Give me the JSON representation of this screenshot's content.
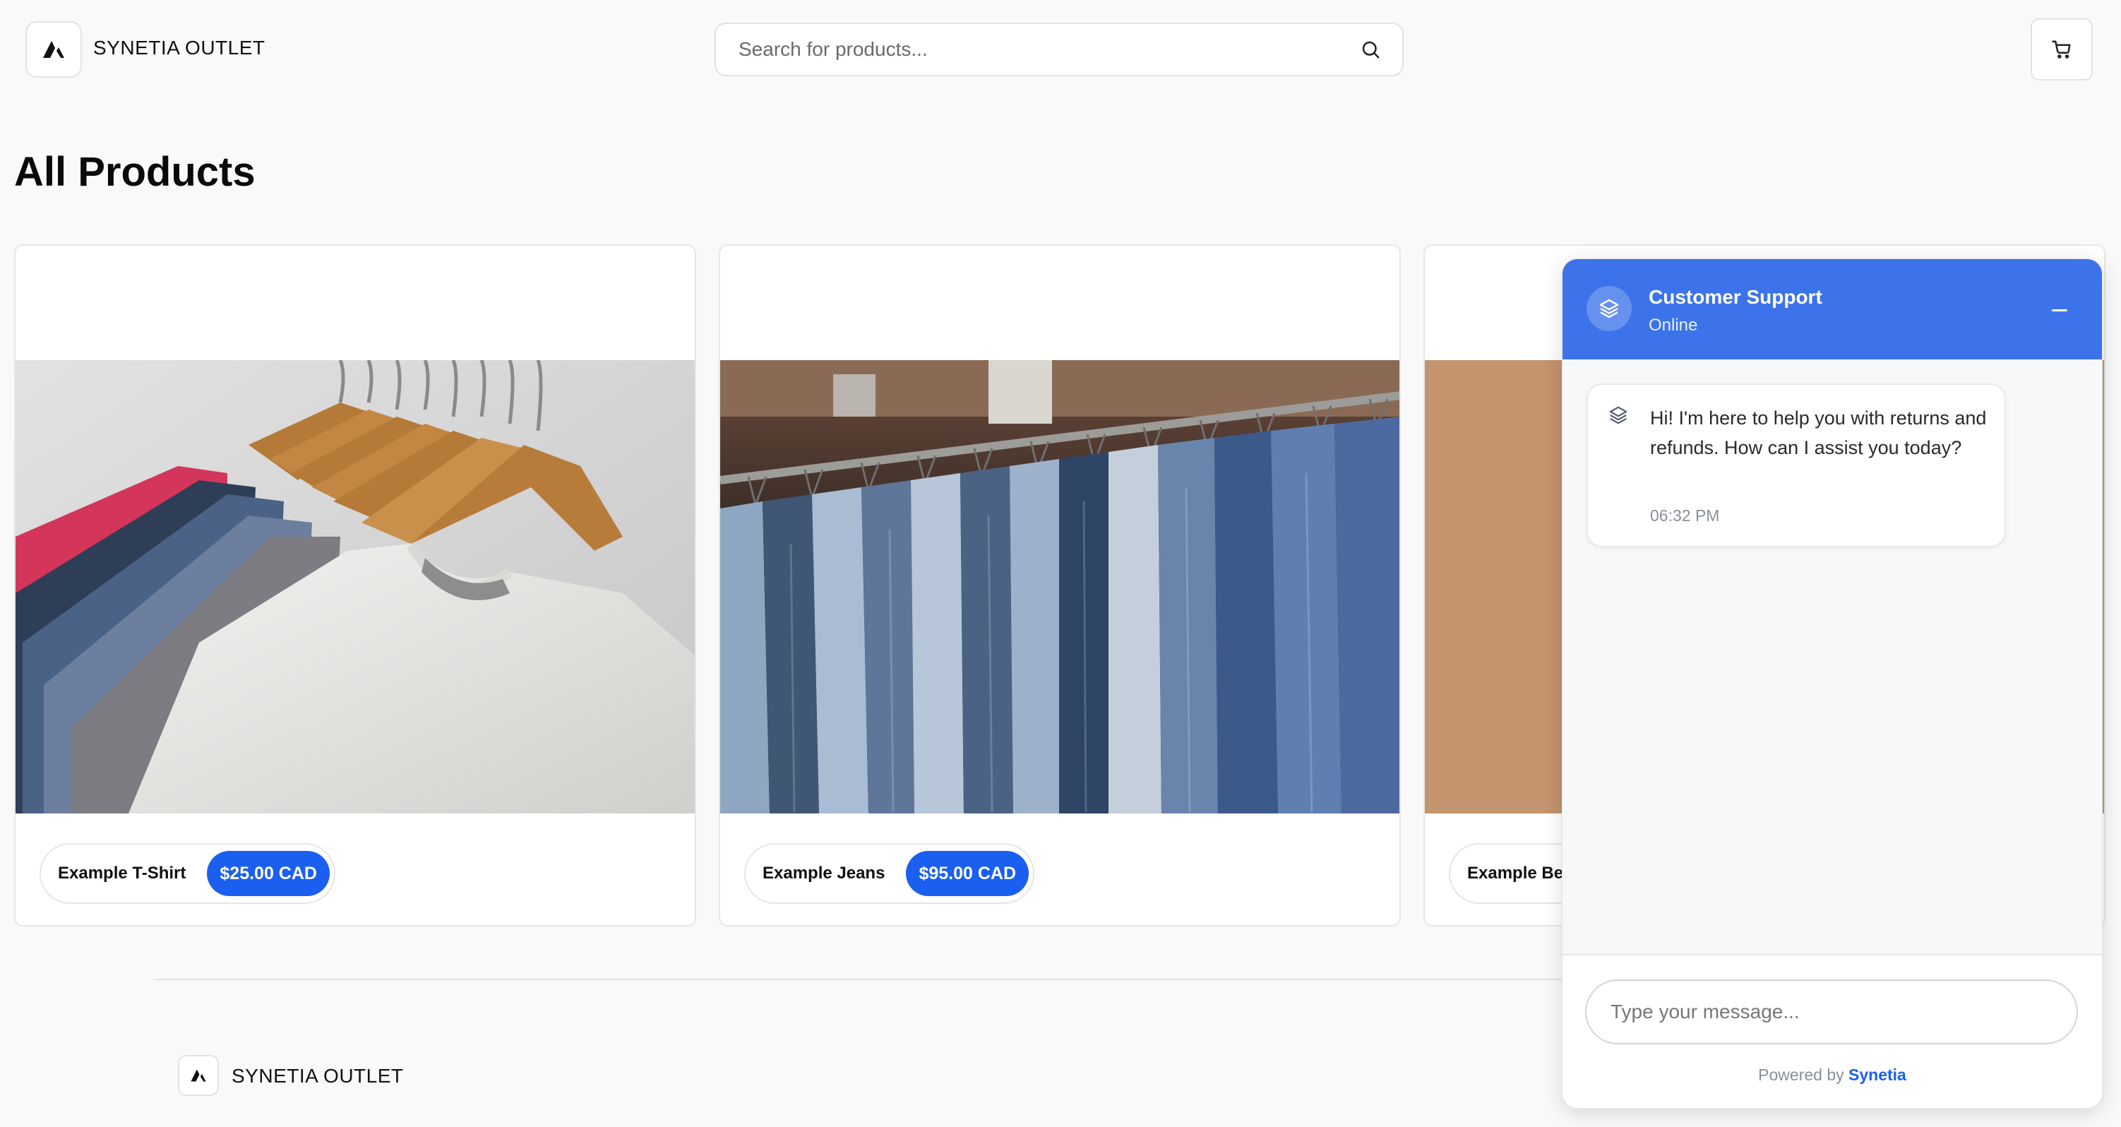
{
  "header": {
    "brand": "SYNETIA OUTLET",
    "search_placeholder": "Search for products..."
  },
  "icons": {
    "logo": "triangle-logo-icon",
    "search": "search-icon",
    "cart": "cart-icon",
    "support": "layers-icon",
    "minimize": "minimize-icon"
  },
  "main": {
    "title": "All Products",
    "products": [
      {
        "name": "Example T-Shirt",
        "price": "$25.00 CAD"
      },
      {
        "name": "Example Jeans",
        "price": "$95.00 CAD"
      },
      {
        "name": "Example Bea",
        "price": ""
      }
    ]
  },
  "footer": {
    "brand": "SYNETIA OUTLET"
  },
  "chat": {
    "title": "Customer Support",
    "status": "Online",
    "message": "Hi! I'm here to help you with returns and refunds. How can I assist you today?",
    "time": "06:32 PM",
    "input_placeholder": "Type your message...",
    "powered_prefix": "Powered by",
    "powered_brand": "Synetia"
  },
  "colors": {
    "accent": "#1a5ff0",
    "chat_header": "#3d73ea",
    "background": "#f9f9f9"
  }
}
